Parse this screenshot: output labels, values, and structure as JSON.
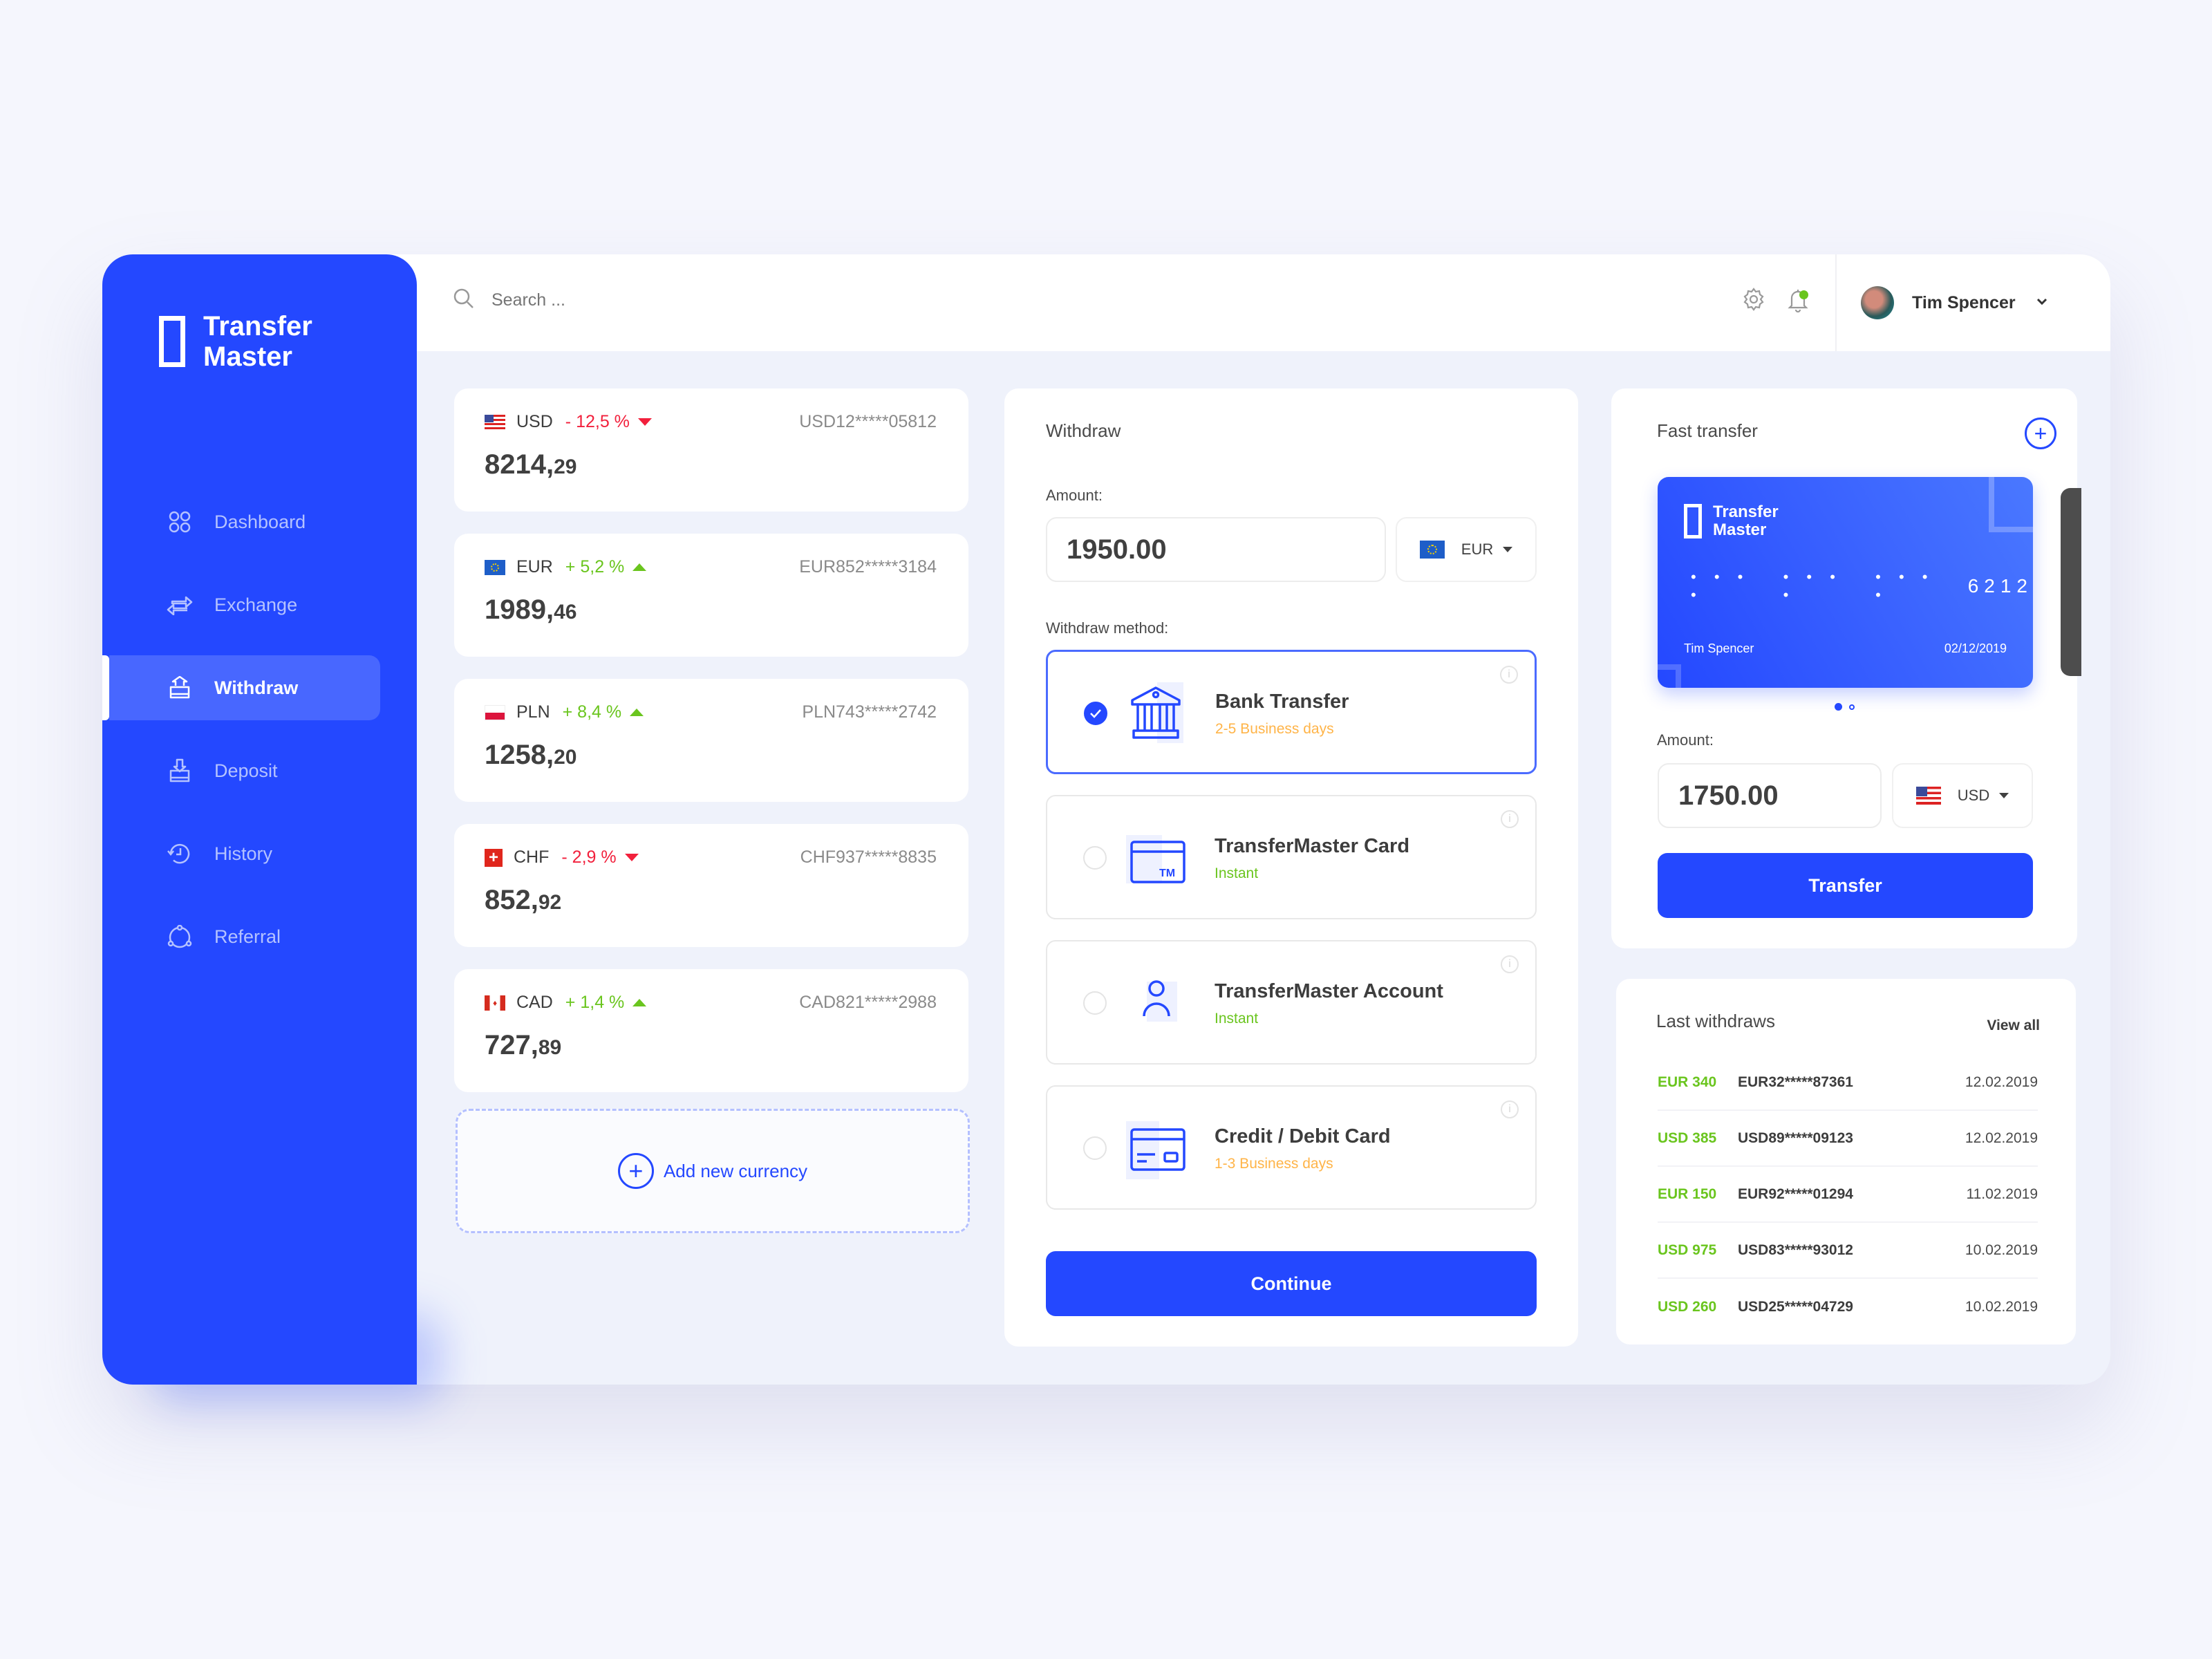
{
  "app": {
    "brand_line1": "Transfer",
    "brand_line2": "Master"
  },
  "sidebar": {
    "items": [
      {
        "label": "Dashboard",
        "icon": "dashboard-icon",
        "active": false
      },
      {
        "label": "Exchange",
        "icon": "exchange-icon",
        "active": false
      },
      {
        "label": "Withdraw",
        "icon": "withdraw-icon",
        "active": true
      },
      {
        "label": "Deposit",
        "icon": "deposit-icon",
        "active": false
      },
      {
        "label": "History",
        "icon": "history-icon",
        "active": false
      },
      {
        "label": "Referral",
        "icon": "referral-icon",
        "active": false
      }
    ]
  },
  "header": {
    "search_placeholder": "Search ...",
    "user_name": "Tim Spencer",
    "notification_dot_color": "#6ac51e"
  },
  "currencies": [
    {
      "code": "USD",
      "change": "- 12,5 %",
      "trend": "down",
      "account": "USD12*****05812",
      "balance_int": "8214,",
      "balance_dec": "29"
    },
    {
      "code": "EUR",
      "change": "+ 5,2 %",
      "trend": "up",
      "account": "EUR852*****3184",
      "balance_int": "1989,",
      "balance_dec": "46"
    },
    {
      "code": "PLN",
      "change": "+ 8,4 %",
      "trend": "up",
      "account": "PLN743*****2742",
      "balance_int": "1258,",
      "balance_dec": "20"
    },
    {
      "code": "CHF",
      "change": "- 2,9 %",
      "trend": "down",
      "account": "CHF937*****8835",
      "balance_int": "852,",
      "balance_dec": "92"
    },
    {
      "code": "CAD",
      "change": "+ 1,4 %",
      "trend": "up",
      "account": "CAD821*****2988",
      "balance_int": "727,",
      "balance_dec": "89"
    }
  ],
  "add_currency_label": "Add new currency",
  "withdraw": {
    "title": "Withdraw",
    "amount_label": "Amount:",
    "amount_value": "1950.00",
    "currency": "EUR",
    "method_label": "Withdraw method:",
    "methods": [
      {
        "name": "Bank Transfer",
        "time": "2-5 Business days",
        "time_color": "orange",
        "selected": true
      },
      {
        "name": "TransferMaster Card",
        "time": "Instant",
        "time_color": "green",
        "selected": false
      },
      {
        "name": "TransferMaster Account",
        "time": "Instant",
        "time_color": "green",
        "selected": false
      },
      {
        "name": "Credit / Debit Card",
        "time": "1-3 Business days",
        "time_color": "orange",
        "selected": false
      }
    ],
    "continue_label": "Continue"
  },
  "fast_transfer": {
    "title": "Fast transfer",
    "card": {
      "brand_line1": "Transfer",
      "brand_line2": "Master",
      "masked_groups": [
        "• • • •",
        "• • • •",
        "• • • •"
      ],
      "last4": "6212",
      "holder": "Tim Spencer",
      "date": "02/12/2019"
    },
    "carousel_active_index": 0,
    "carousel_count": 2,
    "amount_label": "Amount:",
    "amount_value": "1750.00",
    "currency": "USD",
    "transfer_label": "Transfer"
  },
  "last_withdraws": {
    "title": "Last withdraws",
    "view_all_label": "View all",
    "rows": [
      {
        "amount": "EUR 340",
        "account": "EUR32*****87361",
        "date": "12.02.2019"
      },
      {
        "amount": "USD 385",
        "account": "USD89*****09123",
        "date": "12.02.2019"
      },
      {
        "amount": "EUR 150",
        "account": "EUR92*****01294",
        "date": "11.02.2019"
      },
      {
        "amount": "USD 975",
        "account": "USD83*****93012",
        "date": "10.02.2019"
      },
      {
        "amount": "USD 260",
        "account": "USD25*****04729",
        "date": "10.02.2019"
      }
    ]
  },
  "colors": {
    "brand_blue": "#2448ff",
    "positive": "#6ac51e",
    "negative": "#f2203c",
    "pending": "#ffb448"
  }
}
